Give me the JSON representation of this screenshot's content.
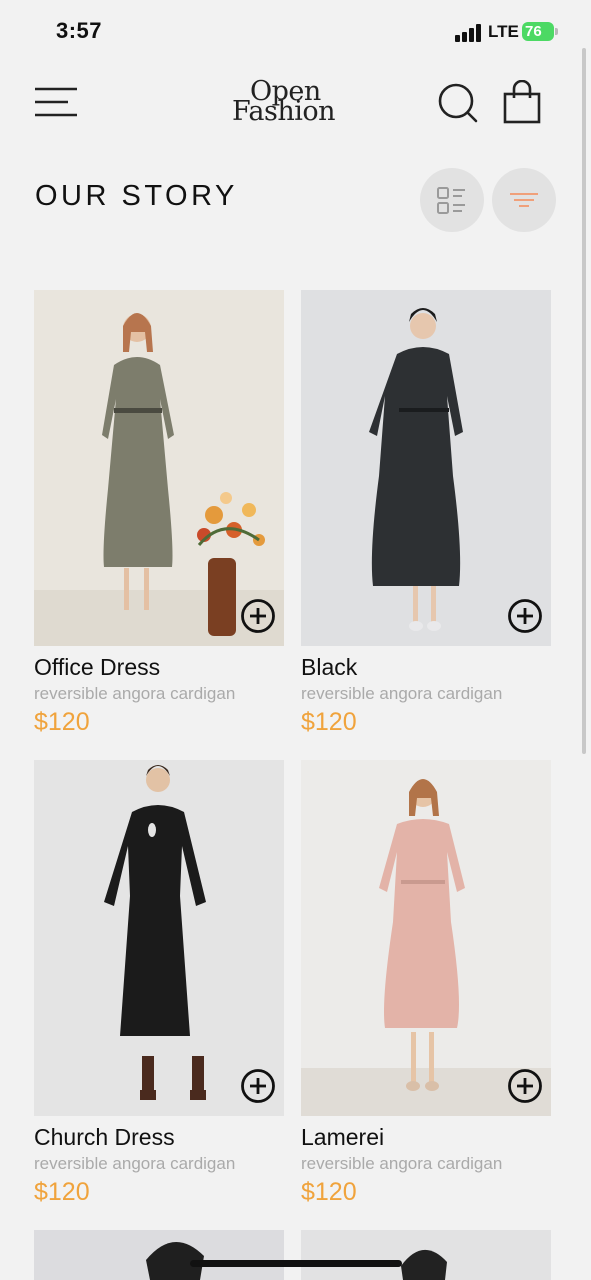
{
  "status_bar": {
    "time": "3:57",
    "network": "LTE",
    "battery": "76"
  },
  "header": {
    "logo_line1": "Open",
    "logo_line2": "Fashion"
  },
  "section": {
    "title": "OUR STORY"
  },
  "colors": {
    "price": "#f0a33c",
    "background": "#f2f2f2",
    "filter_icon": "#f0a07a"
  },
  "icons": [
    "menu-icon",
    "search-icon",
    "shopping-bag-icon",
    "list-view-icon",
    "filter-icon",
    "add-circle-icon"
  ],
  "products": [
    {
      "name": "Office Dress",
      "description": "reversible angora cardigan",
      "price": "$120"
    },
    {
      "name": "Black",
      "description": "reversible angora cardigan",
      "price": "$120"
    },
    {
      "name": "Church Dress",
      "description": "reversible angora cardigan",
      "price": "$120"
    },
    {
      "name": "Lamerei",
      "description": "reversible angora cardigan",
      "price": "$120"
    }
  ]
}
